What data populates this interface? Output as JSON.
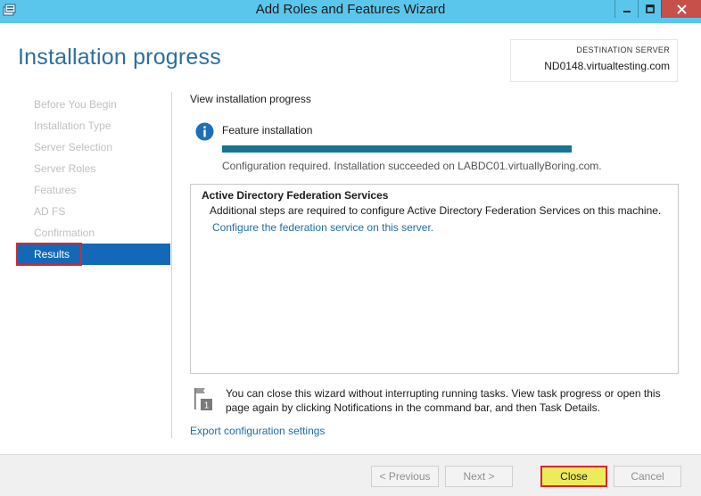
{
  "window": {
    "title": "Add Roles and Features Wizard",
    "icons": {
      "app": "server-manager-icon",
      "minimize": "minimize-icon",
      "maximize": "maximize-icon",
      "close": "close-icon"
    },
    "colors": {
      "titlebar": "#5bc6ec",
      "close": "#c7504b"
    }
  },
  "header": {
    "page_title": "Installation progress",
    "destination_label": "DESTINATION SERVER",
    "destination_server": "ND0148.virtualtesting.com"
  },
  "nav": {
    "items": [
      {
        "label": "Before You Begin",
        "state": "disabled"
      },
      {
        "label": "Installation Type",
        "state": "disabled"
      },
      {
        "label": "Server Selection",
        "state": "disabled"
      },
      {
        "label": "Server Roles",
        "state": "disabled"
      },
      {
        "label": "Features",
        "state": "disabled"
      },
      {
        "label": "AD FS",
        "state": "disabled"
      },
      {
        "label": "Confirmation",
        "state": "disabled"
      },
      {
        "label": "Results",
        "state": "active"
      }
    ],
    "active_color": "#1369b7",
    "highlight_color": "#d9262e"
  },
  "main": {
    "heading": "View installation progress",
    "feature_label": "Feature installation",
    "feature_icon": "info-icon",
    "progress_fraction": 1.0,
    "progress_color": "#17758f",
    "status_text": "Configuration required. Installation succeeded on LABDC01.virtuallyBoring.com.",
    "result": {
      "title": "Active Directory Federation Services",
      "description": "Additional steps are required to configure Active Directory Federation Services on this machine.",
      "link": "Configure the federation service on this server."
    },
    "note_icon": "notification-flag-icon",
    "note_badge": "1",
    "note": "You can close this wizard without interrupting running tasks. View task progress or open this page again by clicking Notifications in the command bar, and then Task Details.",
    "export_link": "Export configuration settings"
  },
  "footer": {
    "previous": "< Previous",
    "next": "Next >",
    "close": "Close",
    "cancel": "Cancel",
    "close_highlight_color": "#ecec5a"
  }
}
